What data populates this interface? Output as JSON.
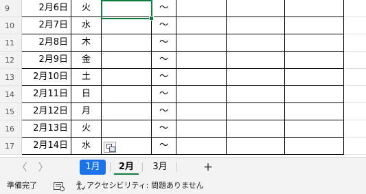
{
  "rows": [
    {
      "num": "9",
      "date": "2月6日",
      "day": "火",
      "tilde": "〜"
    },
    {
      "num": "10",
      "date": "2月7日",
      "day": "水",
      "tilde": "〜"
    },
    {
      "num": "11",
      "date": "2月8日",
      "day": "木",
      "tilde": "〜"
    },
    {
      "num": "12",
      "date": "2月9日",
      "day": "金",
      "tilde": "〜"
    },
    {
      "num": "13",
      "date": "2月10日",
      "day": "土",
      "tilde": "〜"
    },
    {
      "num": "14",
      "date": "2月11日",
      "day": "日",
      "tilde": "〜"
    },
    {
      "num": "15",
      "date": "2月12日",
      "day": "月",
      "tilde": "〜"
    },
    {
      "num": "16",
      "date": "2月13日",
      "day": "火",
      "tilde": "〜"
    },
    {
      "num": "17",
      "date": "2月14日",
      "day": "水",
      "tilde": "〜"
    }
  ],
  "tabs": {
    "nav_left": "〈",
    "nav_right": "〉",
    "sheet1": "1月",
    "sheet2": "2月",
    "sheet3": "3月",
    "add": "+",
    "active_sheet": "2月"
  },
  "status": {
    "ready": "準備完了",
    "accessibility": "アクセシビリティ: 問題ありません"
  },
  "colors": {
    "selection": "#107c41",
    "tab_highlight": "#1a73e8"
  },
  "icons": [
    "paste-options-icon",
    "macro-record-icon",
    "accessibility-icon"
  ]
}
